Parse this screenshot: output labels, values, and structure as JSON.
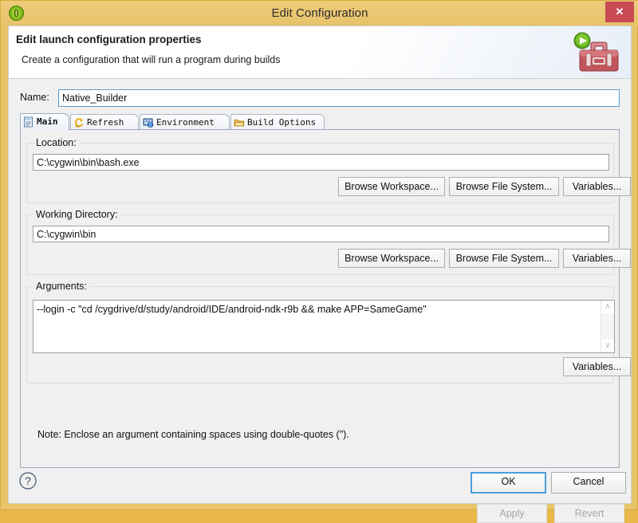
{
  "window": {
    "title": "Edit Configuration",
    "app_icon": "eclipse-icon",
    "close_label": "✕"
  },
  "header": {
    "title": "Edit launch configuration properties",
    "subtitle": "Create a configuration that will run a program during builds",
    "art_icon": "toolbox-run-icon"
  },
  "name_field": {
    "label": "Name:",
    "value": "Native_Builder",
    "placeholder": ""
  },
  "tabs": [
    {
      "label": "Main",
      "icon": "document-icon",
      "active": true
    },
    {
      "label": "Refresh",
      "icon": "refresh-icon",
      "active": false
    },
    {
      "label": "Environment",
      "icon": "environment-icon",
      "active": false
    },
    {
      "label": "Build Options",
      "icon": "folder-icon",
      "active": false
    }
  ],
  "main_tab": {
    "location": {
      "group_label": "Location:",
      "value": "C:\\cygwin\\bin\\bash.exe",
      "browse_workspace": "Browse Workspace...",
      "browse_file_system": "Browse File System...",
      "variables": "Variables..."
    },
    "working_directory": {
      "group_label": "Working Directory:",
      "value": "C:\\cygwin\\bin",
      "browse_workspace": "Browse Workspace...",
      "browse_file_system": "Browse File System...",
      "variables": "Variables..."
    },
    "arguments": {
      "group_label": "Arguments:",
      "value": "--login -c \"cd /cygdrive/d/study/android/IDE/android-ndk-r9b && make APP=SameGame\"",
      "variables": "Variables...",
      "scroll_up": "∧",
      "scroll_down": "∨"
    },
    "note": "Note: Enclose an argument containing spaces using double-quotes (\")."
  },
  "panel_buttons": {
    "apply": "Apply",
    "apply_enabled": false,
    "revert": "Revert",
    "revert_enabled": false
  },
  "footer": {
    "help_icon": "help-icon",
    "ok": "OK",
    "cancel": "Cancel"
  },
  "colors": {
    "window_chrome": "#e8c46a",
    "close_button": "#c94b53",
    "focus_blue": "#4b9ddb",
    "panel_bg": "#f0f0f0",
    "field_bg": "#ffffff"
  }
}
